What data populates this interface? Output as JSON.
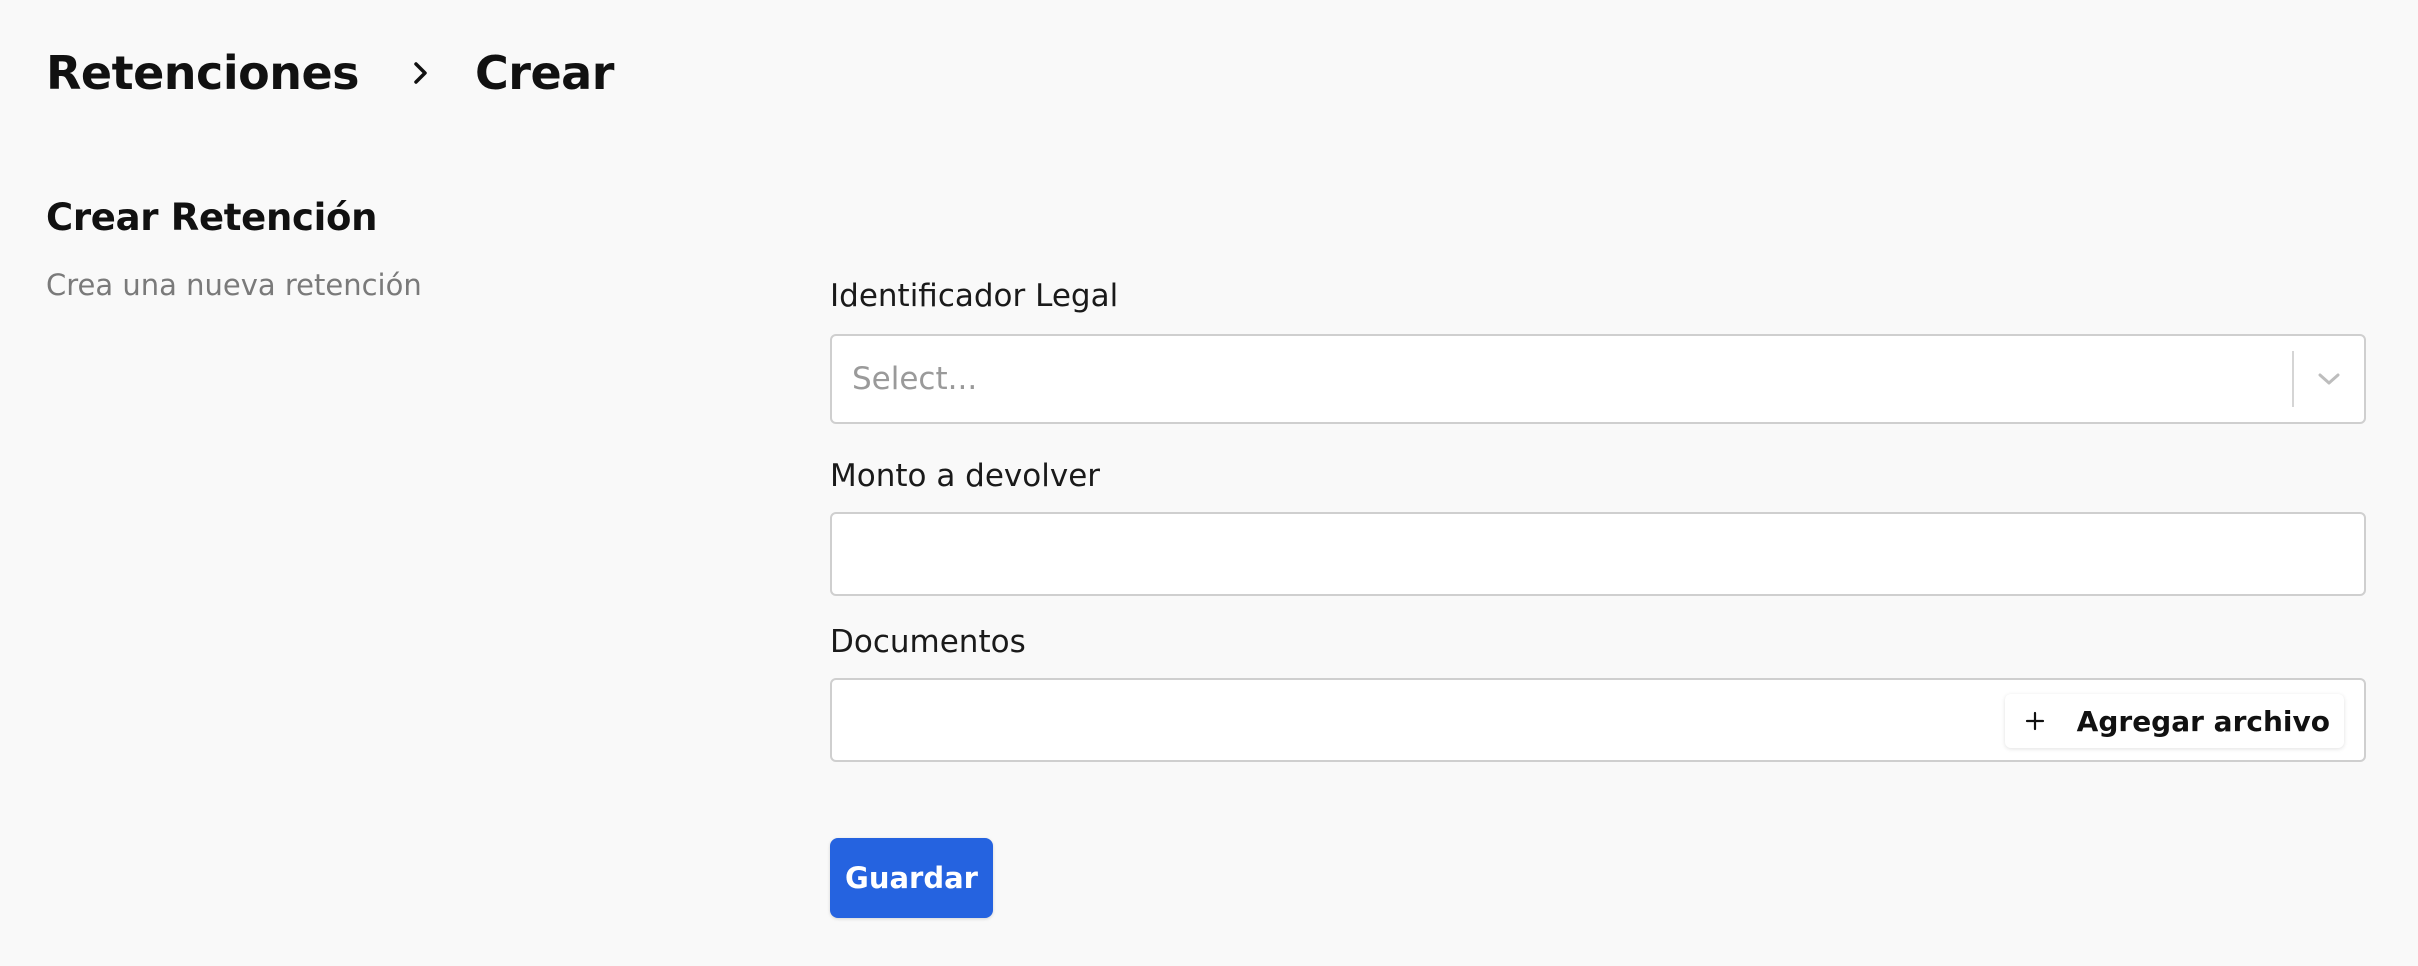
{
  "breadcrumb": {
    "parent": "Retenciones",
    "current": "Crear"
  },
  "section": {
    "title": "Crear Retención",
    "subtitle": "Crea una nueva retención"
  },
  "form": {
    "legal_id": {
      "label": "Identificador Legal",
      "placeholder": "Select..."
    },
    "amount": {
      "label": "Monto a devolver",
      "value": ""
    },
    "documents": {
      "label": "Documentos",
      "add_label": "Agregar archivo"
    }
  },
  "actions": {
    "save_label": "Guardar"
  },
  "icons": {
    "breadcrumb_separator": "chevron-right-icon",
    "select_dropdown": "chevron-down-icon",
    "add_file": "plus-icon"
  },
  "colors": {
    "background": "#f9f9f9",
    "primary": "#2563e0",
    "border": "#cfcfcf",
    "muted_text": "#7a7a7a"
  }
}
